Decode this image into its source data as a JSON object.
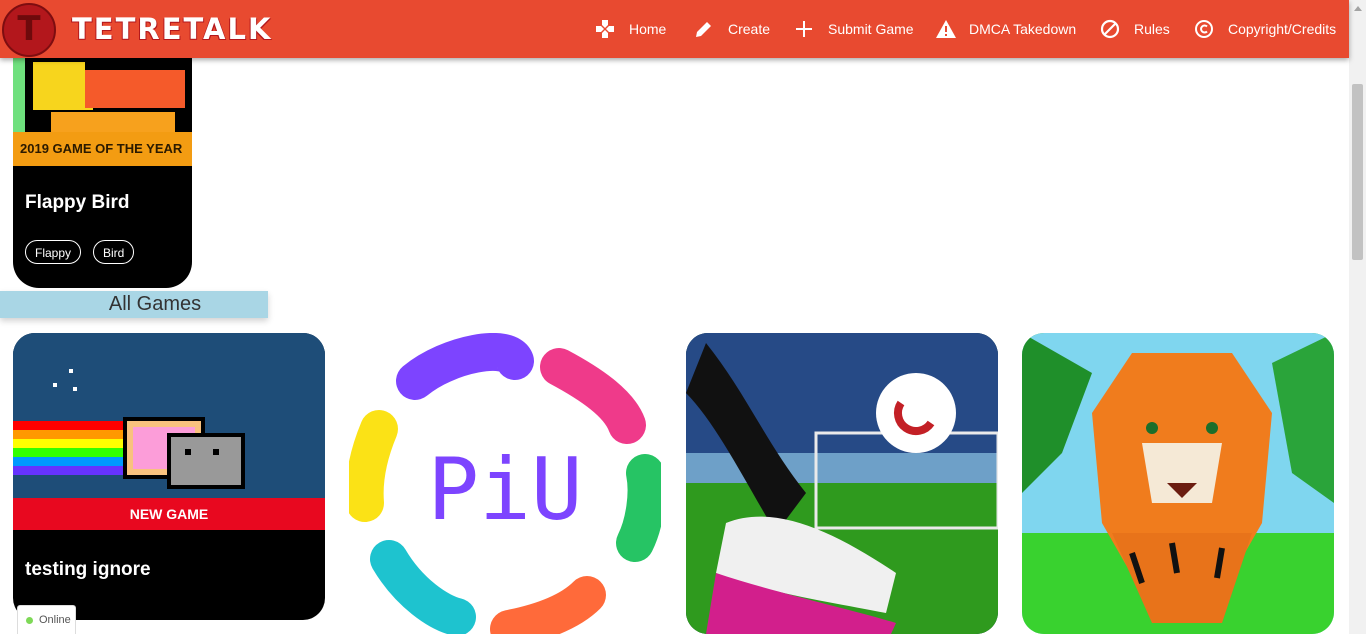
{
  "brand": {
    "name": "TETRETALK",
    "logo_letter": "T"
  },
  "nav": [
    {
      "icon": "gamepad-icon",
      "label": "Home"
    },
    {
      "icon": "pencil-icon",
      "label": "Create"
    },
    {
      "icon": "plus-icon",
      "label": "Submit Game"
    },
    {
      "icon": "warning-icon",
      "label": "DMCA Takedown"
    },
    {
      "icon": "ban-icon",
      "label": "Rules"
    },
    {
      "icon": "copyright-icon",
      "label": "Copyright/Credits"
    }
  ],
  "featured": {
    "badge": "2019 GAME OF THE YEAR",
    "title": "Flappy Bird",
    "tags": [
      "Flappy",
      "Bird"
    ]
  },
  "section_title": "All Games",
  "games": [
    {
      "title": "testing ignore",
      "badge": "NEW GAME",
      "image": "nyan-cat-image"
    },
    {
      "title": "",
      "image": "piu-logo-image",
      "image_text": "PiU"
    },
    {
      "title": "",
      "image": "soccer-kick-image"
    },
    {
      "title": "",
      "image": "tiger-image"
    }
  ],
  "status": {
    "label": "Online"
  },
  "colors": {
    "header": "#e84a30",
    "gold_badge": "#f39c12",
    "new_badge": "#e8081f",
    "section": "#a9d6e5"
  }
}
